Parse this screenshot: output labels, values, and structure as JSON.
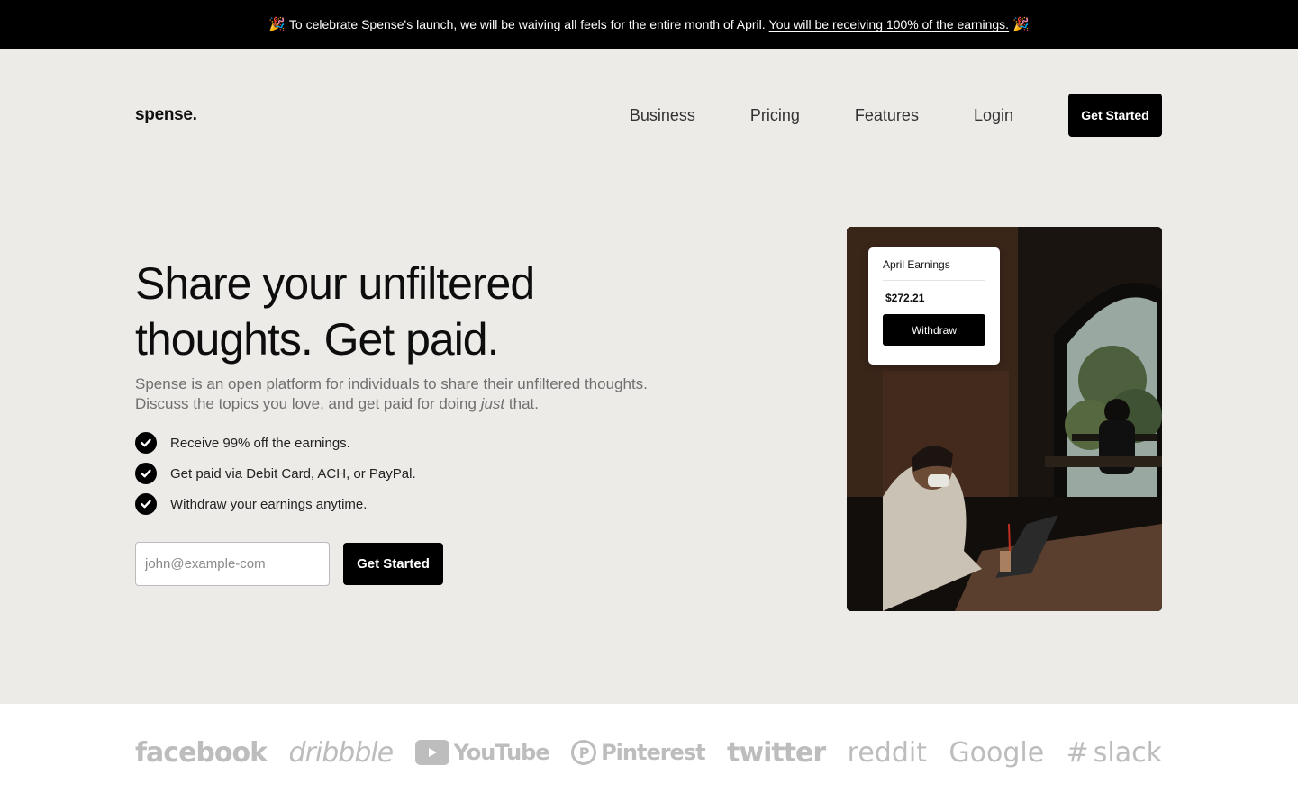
{
  "banner": {
    "emoji": "🎉",
    "text": "To celebrate Spense's launch, we will be waiving all feels for the entire month of April.",
    "link": "You will be receiving 100% of the earnings."
  },
  "nav": {
    "logo": "spense.",
    "links": [
      "Business",
      "Pricing",
      "Features",
      "Login"
    ],
    "cta": "Get Started"
  },
  "hero": {
    "title_line1": "Share your unfiltered",
    "title_line2": "thoughts. Get paid.",
    "subtitle_part1": "Spense is an open platform for individuals to share their unfiltered thoughts. Discuss the topics you love, and get paid for doing",
    "subtitle_em": "just",
    "subtitle_part2": "that.",
    "checks": [
      "Receive 99% off the earnings.",
      "Get paid via Debit Card, ACH, or PayPal.",
      "Withdraw your earnings anytime."
    ],
    "email_placeholder": "john@example-com",
    "signup_cta": "Get Started"
  },
  "card": {
    "title": "April Earnings",
    "amount": "$272.21",
    "button": "Withdraw"
  },
  "logos": [
    "facebook",
    "dribbble",
    "YouTube",
    "Pinterest",
    "twitter",
    "reddit",
    "Google",
    "slack"
  ]
}
